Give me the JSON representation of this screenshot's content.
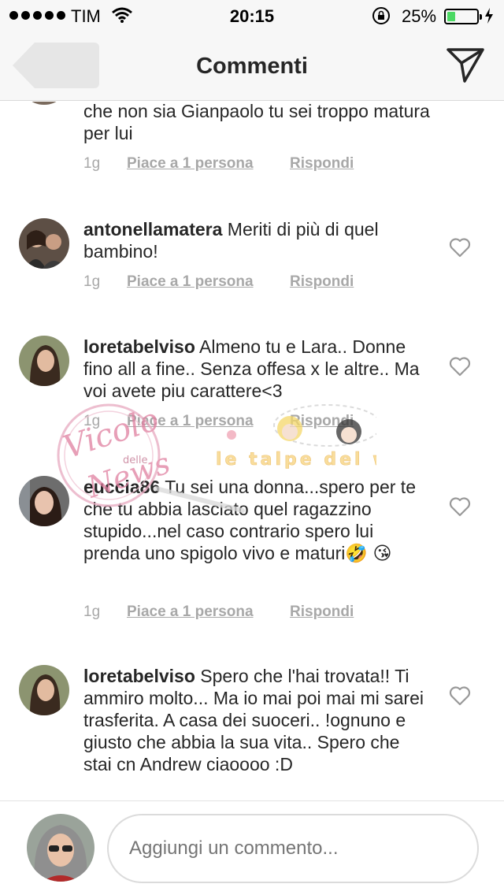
{
  "status_bar": {
    "carrier": "TIM",
    "time": "20:15",
    "battery": "25%",
    "battery_level": 0.25
  },
  "header": {
    "title": "Commenti"
  },
  "comments": [
    {
      "username": "",
      "text": "che non sia Gianpaolo tu sei troppo matura per lui",
      "age": "1g",
      "likes": "Piace a 1 persona",
      "reply": "Rispondi"
    },
    {
      "username": "antonellamatera",
      "text": "Meriti di più di quel bambino!",
      "age": "1g",
      "likes": "Piace a 1 persona",
      "reply": "Rispondi"
    },
    {
      "username": "loretabelviso",
      "text": "Almeno tu e Lara.. Donne fino all a fine.. Senza offesa x le altre.. Ma voi avete piu carattere<3",
      "age": "1g",
      "likes": "Piace a 1 persona",
      "reply": "Rispondi"
    },
    {
      "username": "euccia86",
      "text": "Tu sei una donna...spero per te che tu abbia lasciato quel ragazzino stupido...nel caso contrario spero lui prenda uno spigolo vivo e maturi🤣 😘",
      "age": "1g",
      "likes": "Piace a 1 persona",
      "reply": "Rispondi"
    },
    {
      "username": "loretabelviso",
      "text": "Spero che l'hai trovata!! Ti ammiro molto... Ma io mai poi mai mi sarei trasferita. A casa dei suoceri.. !ognuno e giusto che abbia la sua vita.. Spero che stai cn Andrew ciaoooo :D",
      "age": "",
      "likes": "",
      "reply": ""
    }
  ],
  "watermark": {
    "line1": "Vicolo",
    "line2": "delle",
    "line3": "News",
    "tag": "le talpe del web"
  },
  "composer": {
    "placeholder": "Aggiungi un commento..."
  },
  "colors": {
    "text": "#262626",
    "meta": "#a8a8a8",
    "battery": "#4cd964",
    "bar_bg": "#f7f7f7"
  }
}
